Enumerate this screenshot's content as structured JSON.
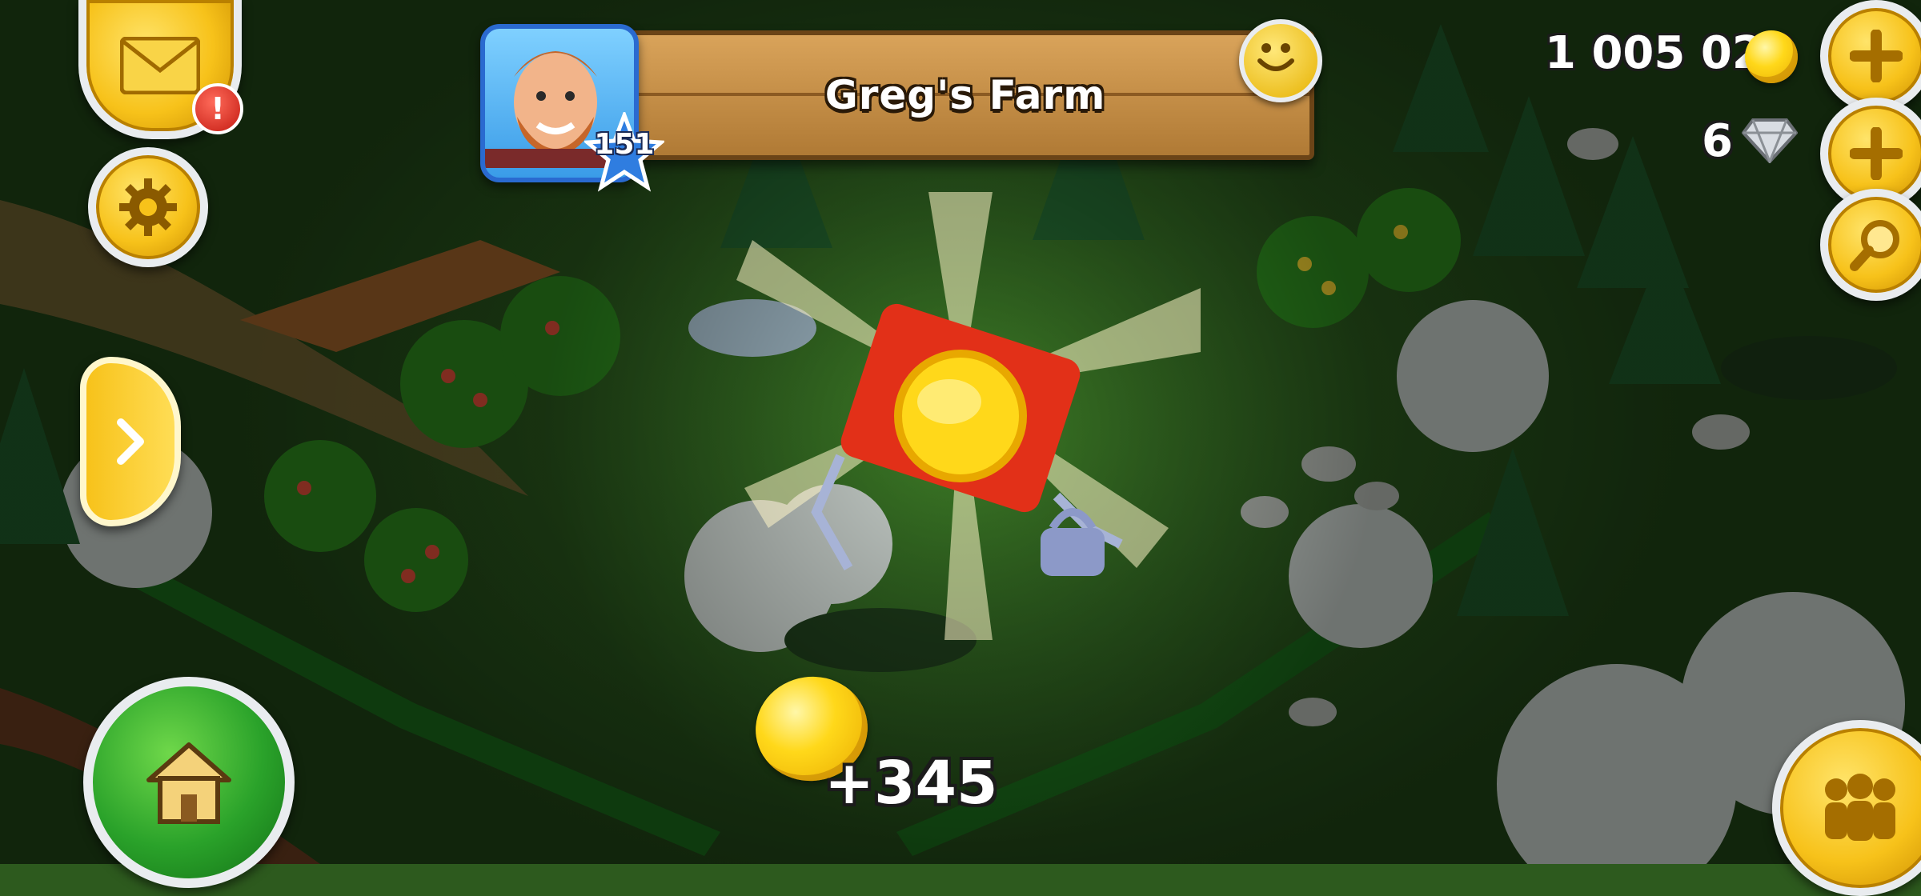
{
  "hud": {
    "farm_name": "Greg's Farm",
    "player_level": "151",
    "coins": "1 005 020",
    "diamonds": "6",
    "reward_amount": "+345"
  },
  "icons": {
    "mail": "envelope-icon",
    "alert": "!",
    "settings": "gear-icon",
    "friends": "smiley-icon",
    "add": "plus-icon",
    "search": "magnifier-icon",
    "expand": "chevron-right-icon",
    "home": "house-icon",
    "neighbors": "people-icon"
  },
  "colors": {
    "accent_yellow": "#f7c21a",
    "home_green": "#2aa22a",
    "banner_wood": "#c58e47",
    "level_blue": "#2a6ad0"
  }
}
